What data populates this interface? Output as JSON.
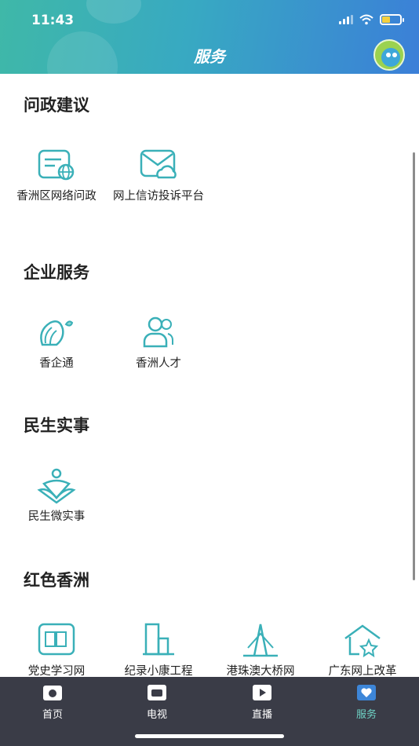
{
  "status_bar": {
    "time": "11:43",
    "battery_percent": 45
  },
  "header": {
    "title": "服务",
    "avatar_icon": "bird-avatar-icon"
  },
  "sections": [
    {
      "title": "问政建议",
      "items": [
        {
          "label": "香洲区网络问政",
          "icon": "web-inquiry-icon"
        },
        {
          "label": "网上信访投诉平台",
          "icon": "mail-cloud-icon"
        }
      ]
    },
    {
      "title": "企业服务",
      "items": [
        {
          "label": "香企通",
          "icon": "shell-icon"
        },
        {
          "label": "香洲人才",
          "icon": "people-icon"
        }
      ]
    },
    {
      "title": "民生实事",
      "items": [
        {
          "label": "民生微实事",
          "icon": "heart-hands-icon"
        }
      ]
    },
    {
      "title": "红色香洲",
      "items": [
        {
          "label": "党史学习网",
          "icon": "book-icon"
        },
        {
          "label": "纪录小康工程",
          "icon": "building-icon"
        },
        {
          "label": "港珠澳大桥网",
          "icon": "bridge-icon"
        },
        {
          "label": "广东网上改革",
          "icon": "house-star-icon"
        }
      ]
    }
  ],
  "tabbar": [
    {
      "label": "首页",
      "icon": "home-camera-icon",
      "active": false
    },
    {
      "label": "电视",
      "icon": "tv-icon",
      "active": false
    },
    {
      "label": "直播",
      "icon": "play-icon",
      "active": false
    },
    {
      "label": "服务",
      "icon": "heart-service-icon",
      "active": true
    }
  ],
  "colors": {
    "icon_teal": "#3ab0b8",
    "tab_active": "#6fd3c6",
    "tabbar_bg": "#3a3c47"
  }
}
